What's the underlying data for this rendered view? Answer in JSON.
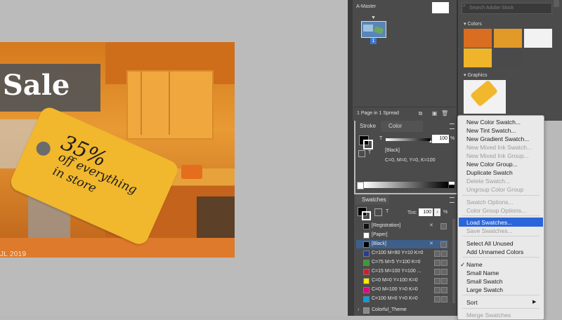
{
  "canvas": {
    "sale_title": "g Sale",
    "tag": {
      "percent": "35%",
      "line1": "off everything",
      "line2": "in store"
    },
    "footer_text": "JL 2019"
  },
  "pages_panel": {
    "master_label": "A-Master",
    "page_number": "1",
    "status": "1 Page in 1 Spread"
  },
  "cc_panel": {
    "search_placeholder": "Search Adobe Stock",
    "colors_heading": "Colors",
    "colors": [
      "#d96d22",
      "#e19a28",
      "#f2f2f2",
      "#efb42a",
      "#4a4a4a"
    ],
    "graphics_heading": "Graphics"
  },
  "color_panel": {
    "tab_stroke": "Stroke",
    "tab_color": "Color",
    "tint_value": "100",
    "percent": "%",
    "swatch_name": "[Black]",
    "cmyk": "C=0, M=0, Y=0, K=100"
  },
  "swatches_panel": {
    "title": "Swatches",
    "tint_label": "Tint:",
    "tint_value": "100",
    "tint_suffix": "%",
    "items": [
      {
        "name": "[Registration]",
        "color": "#111111"
      },
      {
        "name": "[Paper]",
        "color": "#ffffff"
      },
      {
        "name": "[Black]",
        "color": "#000000"
      },
      {
        "name": "C=100 M=90 Y=10 K=0",
        "color": "#2a3d93"
      },
      {
        "name": "C=75 M=5 Y=100 K=0",
        "color": "#3d9a35"
      },
      {
        "name": "C=15 M=100 Y=100 ...",
        "color": "#cf2027"
      },
      {
        "name": "C=0 M=0 Y=100 K=0",
        "color": "#ffe800"
      },
      {
        "name": "C=0 M=100 Y=0 K=0",
        "color": "#e4007f"
      },
      {
        "name": "C=100 M=0 Y=0 K=0",
        "color": "#00a0e6"
      },
      {
        "name": "Colorful_Theme",
        "color": "#888888"
      }
    ]
  },
  "menu": {
    "items": [
      {
        "label": "New Color Swatch...",
        "enabled": true
      },
      {
        "label": "New Tint Swatch...",
        "enabled": true
      },
      {
        "label": "New Gradient Swatch...",
        "enabled": true
      },
      {
        "label": "New Mixed Ink Swatch...",
        "enabled": false
      },
      {
        "label": "New Mixed Ink Group...",
        "enabled": false
      },
      {
        "label": "New Color Group...",
        "enabled": true
      },
      {
        "label": "Duplicate Swatch",
        "enabled": true
      },
      {
        "label": "Delete Swatch...",
        "enabled": false
      },
      {
        "label": "Ungroup Color Group",
        "enabled": false
      },
      {
        "label": "Swatch Options...",
        "enabled": false
      },
      {
        "label": "Color Group Options...",
        "enabled": false
      },
      {
        "label": "Load Swatches...",
        "enabled": true,
        "highlighted": true
      },
      {
        "label": "Save Swatches...",
        "enabled": false
      },
      {
        "label": "Select All Unused",
        "enabled": true
      },
      {
        "label": "Add Unnamed Colors",
        "enabled": true
      },
      {
        "label": "Name",
        "enabled": true,
        "checked": true
      },
      {
        "label": "Small Name",
        "enabled": true
      },
      {
        "label": "Small Swatch",
        "enabled": true
      },
      {
        "label": "Large Swatch",
        "enabled": true
      },
      {
        "label": "Sort",
        "enabled": true,
        "submenu": true
      },
      {
        "label": "Merge Swatches",
        "enabled": false
      }
    ]
  }
}
